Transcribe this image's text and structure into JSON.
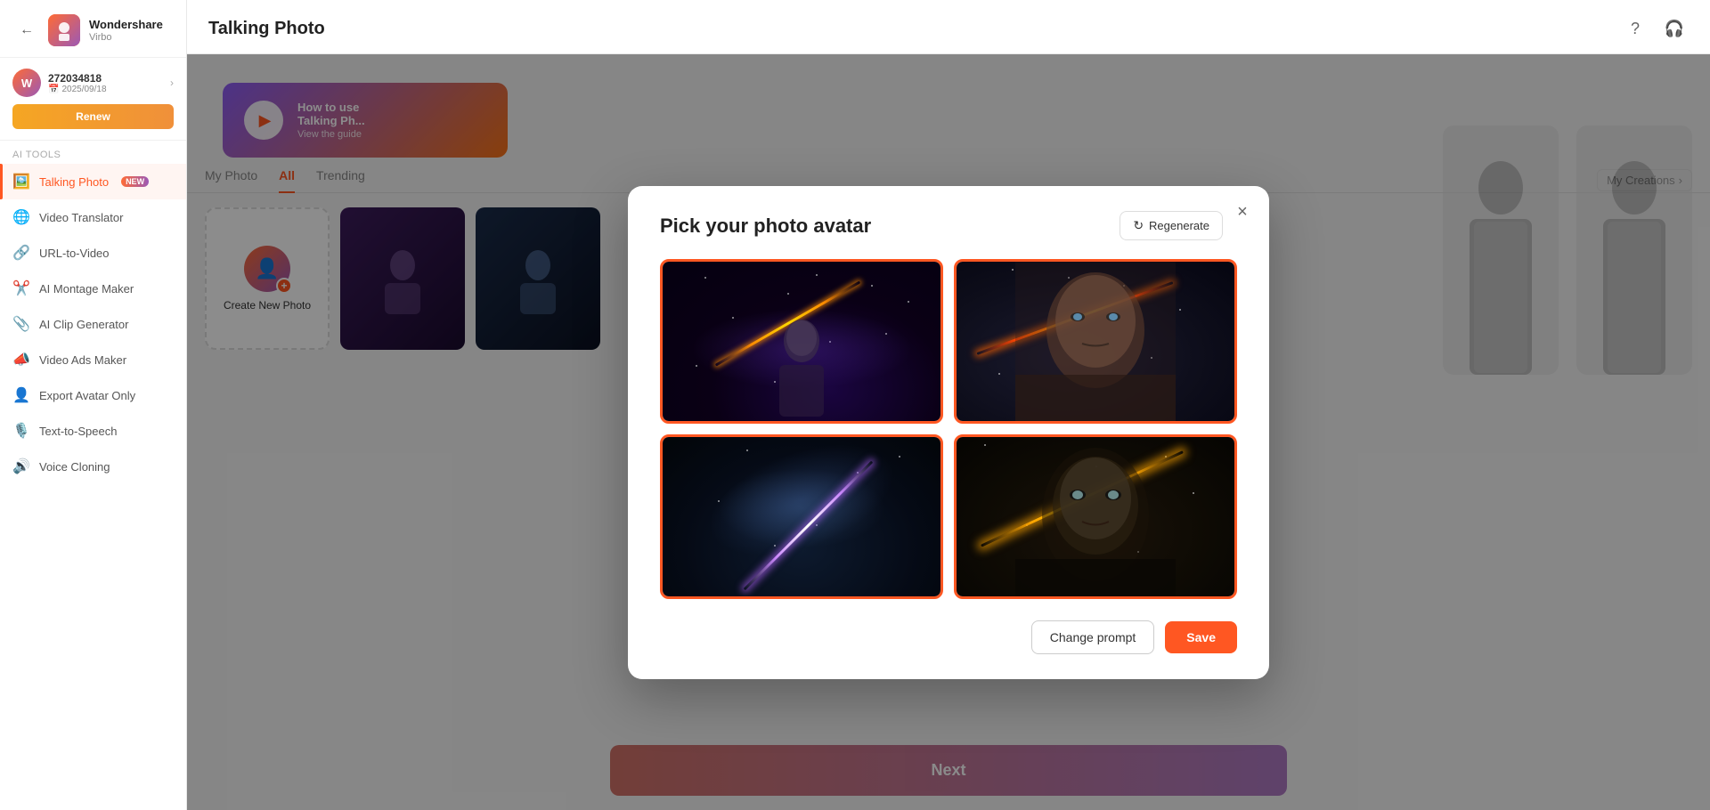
{
  "app": {
    "brand": "Wondershare",
    "sub_brand": "Virbo",
    "back_label": "←"
  },
  "user": {
    "id": "272034818",
    "expiry": "2025/09/18",
    "renew_label": "Renew",
    "avatar_letter": "W"
  },
  "sidebar": {
    "section_label": "AI Tools",
    "items": [
      {
        "id": "talking-photo",
        "label": "Talking Photo",
        "icon": "🖼️",
        "is_new": true,
        "active": true
      },
      {
        "id": "video-translator",
        "label": "Video Translator",
        "icon": "🌐",
        "is_new": false,
        "active": false
      },
      {
        "id": "url-to-video",
        "label": "URL-to-Video",
        "icon": "🔗",
        "is_new": false,
        "active": false
      },
      {
        "id": "ai-montage-maker",
        "label": "AI Montage Maker",
        "icon": "✂️",
        "is_new": false,
        "active": false
      },
      {
        "id": "ai-clip-generator",
        "label": "AI Clip Generator",
        "icon": "📎",
        "is_new": false,
        "active": false
      },
      {
        "id": "video-ads-maker",
        "label": "Video Ads Maker",
        "icon": "📣",
        "is_new": false,
        "active": false
      },
      {
        "id": "export-avatar-only",
        "label": "Export Avatar Only",
        "icon": "👤",
        "is_new": false,
        "active": false
      },
      {
        "id": "text-to-speech",
        "label": "Text-to-Speech",
        "icon": "🎙️",
        "is_new": false,
        "active": false
      },
      {
        "id": "voice-cloning",
        "label": "Voice Cloning",
        "icon": "🔊",
        "is_new": false,
        "active": false
      }
    ]
  },
  "main": {
    "title": "Talking Photo",
    "tutorial": {
      "title": "How to use Talking Ph...",
      "subtitle": "View the guide",
      "play_label": "▶"
    },
    "tabs": [
      {
        "id": "my-photo",
        "label": "My Photo",
        "active": false
      },
      {
        "id": "all",
        "label": "All",
        "active": true
      },
      {
        "id": "trending",
        "label": "Trending",
        "active": false
      }
    ],
    "my_creations_label": "My Creations",
    "create_new_label": "Create New Photo",
    "next_label": "Next"
  },
  "modal": {
    "title": "Pick your photo avatar",
    "regenerate_label": "Regenerate",
    "change_prompt_label": "Change prompt",
    "save_label": "Save",
    "close_label": "×",
    "photos": [
      {
        "id": 1,
        "checked": true,
        "bg": "space1"
      },
      {
        "id": 2,
        "checked": true,
        "bg": "space2"
      },
      {
        "id": 3,
        "checked": true,
        "bg": "space3"
      },
      {
        "id": 4,
        "checked": true,
        "bg": "space4"
      }
    ]
  },
  "icons": {
    "help": "?",
    "headphone": "🎧",
    "back": "←",
    "check": "✓",
    "refresh": "↻",
    "chevron_right": "›",
    "calendar": "📅",
    "play": "▶",
    "person": "👤",
    "scissors": "✂",
    "mic": "🎙",
    "speaker": "🔊",
    "link": "🔗",
    "globe": "🌐",
    "clip": "📎",
    "megaphone": "📣"
  }
}
